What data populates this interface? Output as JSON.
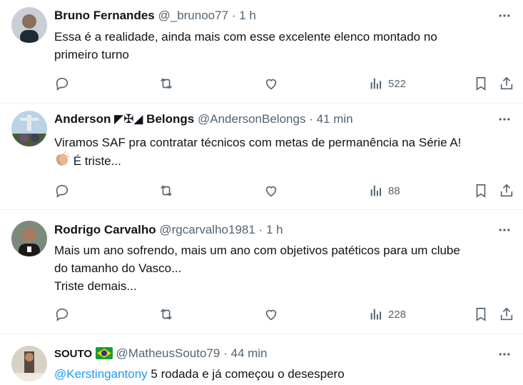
{
  "tweets": [
    {
      "name": "Bruno Fernandes",
      "badge": "",
      "handle": "@_brunoo77",
      "dot": "·",
      "time": "1 h",
      "lines": [
        "Essa é a realidade, ainda mais com esse excelente elenco montado no",
        "primeiro turno"
      ],
      "views": "522"
    },
    {
      "name": "Anderson ◤✠◢ Belongs",
      "handle": "@AndersonBelongs",
      "dot": "·",
      "time": "41 min",
      "lines": [
        "Viramos SAF pra contratar técnicos com metas de permanência na Série A!",
        "É triste..."
      ],
      "views": "88"
    },
    {
      "name": "Rodrigo Carvalho",
      "handle": "@rgcarvalho1981",
      "dot": "·",
      "time": "1 h",
      "lines": [
        "Mais um ano sofrendo, mais um ano com objetivos patéticos para um clube",
        "do tamanho do Vasco...",
        "Triste demais..."
      ],
      "views": "228"
    },
    {
      "name": "SOUTO",
      "handle": "@MatheusSouto79",
      "dot": "·",
      "time": "44 min",
      "mention": "@Kerstingantony",
      "text": "5 rodada e já começou o desespero"
    }
  ],
  "icons": {
    "reply": "reply-icon",
    "retweet": "retweet-icon",
    "like": "like-icon",
    "views": "views-icon",
    "bookmark": "bookmark-icon",
    "share": "share-icon",
    "more": "more-icon",
    "clap": "clapping-hands-emoji",
    "flag": "brazil-flag-emoji"
  },
  "colors": {
    "text": "#0f1419",
    "muted": "#536471",
    "link": "#1d9bf0",
    "divider": "#eff3f4"
  }
}
